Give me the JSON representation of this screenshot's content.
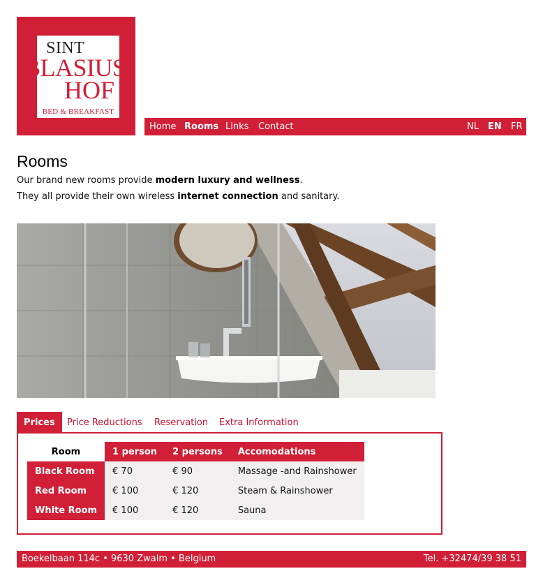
{
  "logo": {
    "sint": "SINT",
    "blasius": "BLASIUS",
    "hof": "HOF",
    "tagline": "BED & BREAKFAST"
  },
  "nav": {
    "items": [
      "Home",
      "Rooms",
      "Links",
      "Contact"
    ],
    "active": "Rooms",
    "languages": [
      "NL",
      "EN",
      "FR"
    ],
    "active_language": "EN"
  },
  "page": {
    "title": "Rooms",
    "intro1_a": "Our brand new rooms provide ",
    "intro1_b": "modern luxury and wellness",
    "intro1_c": ".",
    "intro2_a": "They all provide their own wireless ",
    "intro2_b": "internet connection",
    "intro2_c": " and sanitary."
  },
  "tabs": {
    "items": [
      "Prices",
      "Price Reductions",
      "Reservation",
      "Extra Information"
    ],
    "active": "Prices"
  },
  "prices": {
    "headers": [
      "Room",
      "1 person",
      "2 persons",
      "Accomodations"
    ],
    "rows": [
      [
        "Black Room",
        "€ 70",
        "€ 90",
        "Massage -and Rainshower"
      ],
      [
        "Red Room",
        "€ 100",
        "€ 120",
        "Steam & Rainshower"
      ],
      [
        "White Room",
        "€ 100",
        "€ 120",
        "Sauna"
      ]
    ]
  },
  "footer": {
    "address": "Boekelbaan 114c • 9630 Zwalm • Belgium",
    "phone": "Tel. +32474/39 38 51"
  },
  "colors": {
    "brand": "#d01f36",
    "cell_bg": "#f3eff0"
  }
}
